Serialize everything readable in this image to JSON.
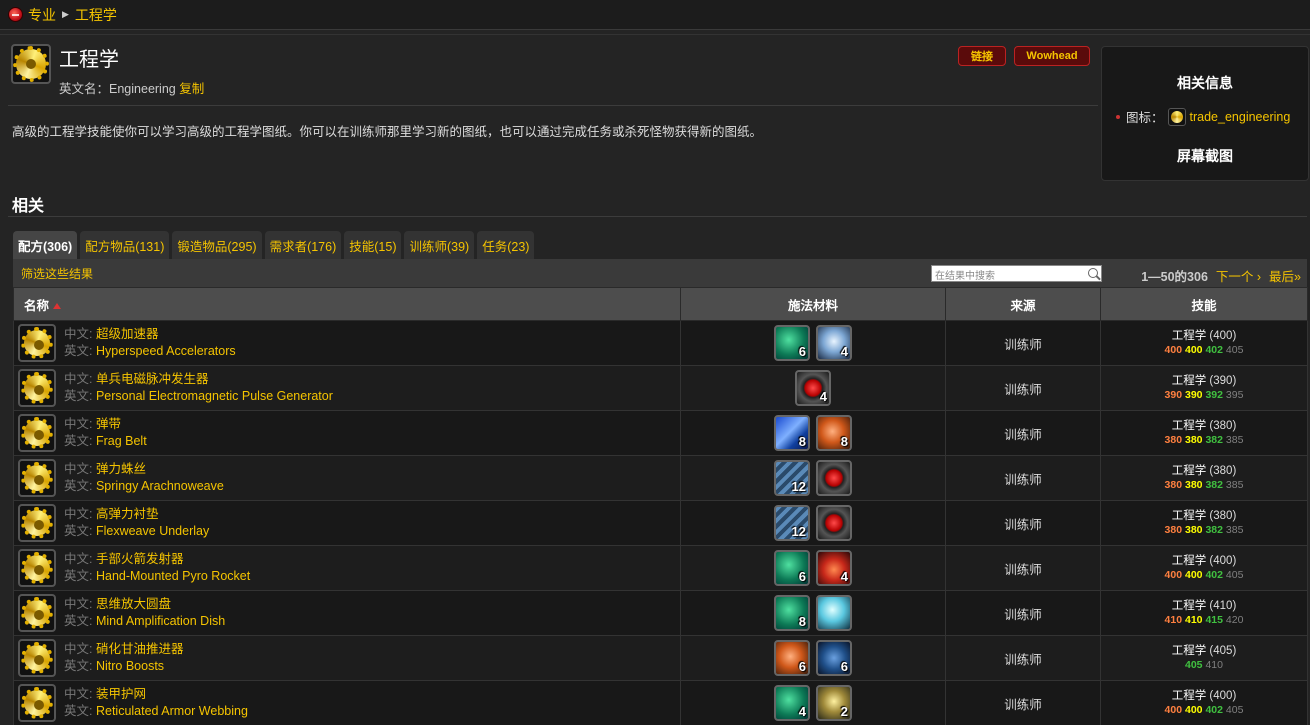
{
  "breadcrumb": {
    "items": [
      "专业",
      "工程学"
    ]
  },
  "header": {
    "title": "工程学",
    "en_label": "英文名：",
    "en_name": "Engineering",
    "copy_link": "复制",
    "link_button": "链接",
    "wowhead_button": "Wowhead"
  },
  "sidebar": {
    "heading": "相关信息",
    "icon_label": "图标：",
    "icon_name": "trade_engineering",
    "screenshot_heading": "屏幕截图"
  },
  "description": "高级的工程学技能使你可以学习高级的工程学图纸。你可以在训练师那里学习新的图纸，也可以通过完成任务或杀死怪物获得新的图纸。",
  "related_heading": "相关",
  "tabs": [
    {
      "label": "配方(306)",
      "active": true
    },
    {
      "label": "配方物品(131)"
    },
    {
      "label": "锻造物品(295)"
    },
    {
      "label": "需求者(176)"
    },
    {
      "label": "技能(15)"
    },
    {
      "label": "训练师(39)"
    },
    {
      "label": "任务(23)"
    }
  ],
  "toolbar": {
    "filter_link": "筛选这些结果",
    "search_placeholder": "在结果中搜索",
    "count": "1—50的306",
    "next": "下一个 ›",
    "last": "最后»"
  },
  "table": {
    "columns": [
      "名称",
      "施法材料",
      "来源",
      "技能"
    ],
    "cn_prefix": "中文:",
    "en_prefix": "英文:",
    "rows": [
      {
        "cn": "超级加速器",
        "en": "Hyperspeed Accelerators",
        "reagents": [
          {
            "icon": "green-gem",
            "qty": "6"
          },
          {
            "icon": "crystal",
            "qty": "4"
          }
        ],
        "source": "训练师",
        "skill": "工程学",
        "skill_req": "(400)",
        "lv": [
          "400",
          "400",
          "402",
          "405"
        ]
      },
      {
        "cn": "单兵电磁脉冲发生器",
        "en": "Personal Electromagnetic Pulse Generator",
        "reagents": [
          {
            "icon": "red-orb",
            "qty": "4"
          }
        ],
        "source": "训练师",
        "skill": "工程学",
        "skill_req": "(390)",
        "lv": [
          "390",
          "390",
          "392",
          "395"
        ]
      },
      {
        "cn": "弹带",
        "en": "Frag Belt",
        "reagents": [
          {
            "icon": "blue-bar",
            "qty": "8"
          },
          {
            "icon": "orange-ore",
            "qty": "8"
          }
        ],
        "source": "训练师",
        "skill": "工程学",
        "skill_req": "(380)",
        "lv": [
          "380",
          "380",
          "382",
          "385"
        ]
      },
      {
        "cn": "弹力蛛丝",
        "en": "Springy Arachnoweave",
        "reagents": [
          {
            "icon": "cloth",
            "qty": "12"
          },
          {
            "icon": "red-orb",
            "qty": ""
          }
        ],
        "source": "训练师",
        "skill": "工程学",
        "skill_req": "(380)",
        "lv": [
          "380",
          "380",
          "382",
          "385"
        ]
      },
      {
        "cn": "高弹力衬垫",
        "en": "Flexweave Underlay",
        "reagents": [
          {
            "icon": "cloth",
            "qty": "12"
          },
          {
            "icon": "red-orb",
            "qty": ""
          }
        ],
        "source": "训练师",
        "skill": "工程学",
        "skill_req": "(380)",
        "lv": [
          "380",
          "380",
          "382",
          "385"
        ]
      },
      {
        "cn": "手部火箭发射器",
        "en": "Hand-Mounted Pyro Rocket",
        "reagents": [
          {
            "icon": "green-gem",
            "qty": "6"
          },
          {
            "icon": "fire",
            "qty": "4"
          }
        ],
        "source": "训练师",
        "skill": "工程学",
        "skill_req": "(400)",
        "lv": [
          "400",
          "400",
          "402",
          "405"
        ]
      },
      {
        "cn": "思维放大圆盘",
        "en": "Mind Amplification Dish",
        "reagents": [
          {
            "icon": "green-gem",
            "qty": "8"
          },
          {
            "icon": "orb",
            "qty": ""
          }
        ],
        "source": "训练师",
        "skill": "工程学",
        "skill_req": "(410)",
        "lv": [
          "410",
          "410",
          "415",
          "420"
        ]
      },
      {
        "cn": "硝化甘油推进器",
        "en": "Nitro Boosts",
        "reagents": [
          {
            "icon": "orange-ore",
            "qty": "6"
          },
          {
            "icon": "bolt",
            "qty": "6"
          }
        ],
        "source": "训练师",
        "skill": "工程学",
        "skill_req": "(405)",
        "lv": [
          "",
          "",
          "405",
          "410"
        ]
      },
      {
        "cn": "装甲护网",
        "en": "Reticulated Armor Webbing",
        "reagents": [
          {
            "icon": "green-gem",
            "qty": "4"
          },
          {
            "icon": "shield",
            "qty": "2"
          }
        ],
        "source": "训练师",
        "skill": "工程学",
        "skill_req": "(400)",
        "lv": [
          "400",
          "400",
          "402",
          "405"
        ]
      }
    ]
  }
}
